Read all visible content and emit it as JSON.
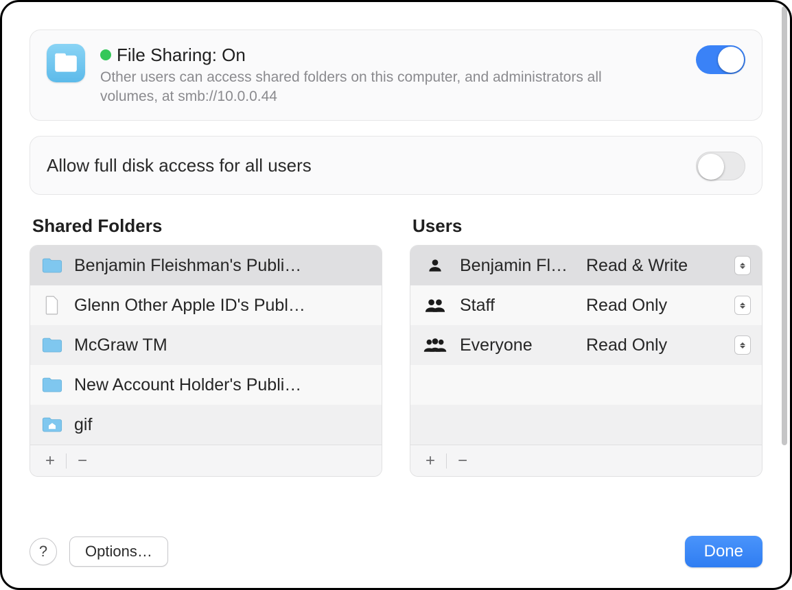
{
  "header": {
    "title": "File Sharing: On",
    "description": "Other users can access shared folders on this computer, and administrators all volumes, at smb://10.0.0.44",
    "toggle_on": true
  },
  "full_disk": {
    "label": "Allow full disk access for all users",
    "toggle_on": false
  },
  "folders": {
    "heading": "Shared Folders",
    "items": [
      {
        "label": "Benjamin Fleishman's Publi…",
        "icon": "folder",
        "selected": true
      },
      {
        "label": "Glenn Other Apple ID's Publ…",
        "icon": "file",
        "selected": false
      },
      {
        "label": "McGraw TM",
        "icon": "folder",
        "selected": false
      },
      {
        "label": "New Account Holder's Publi…",
        "icon": "folder",
        "selected": false
      },
      {
        "label": "gif",
        "icon": "home",
        "selected": false
      }
    ]
  },
  "users": {
    "heading": "Users",
    "items": [
      {
        "name": "Benjamin Flei…",
        "perm": "Read & Write",
        "icon": "person",
        "selected": true
      },
      {
        "name": "Staff",
        "perm": "Read Only",
        "icon": "pair",
        "selected": false
      },
      {
        "name": "Everyone",
        "perm": "Read Only",
        "icon": "group",
        "selected": false
      }
    ]
  },
  "footer_buttons": {
    "add": "+",
    "remove": "−"
  },
  "bottom": {
    "help": "?",
    "options": "Options…",
    "done": "Done"
  }
}
